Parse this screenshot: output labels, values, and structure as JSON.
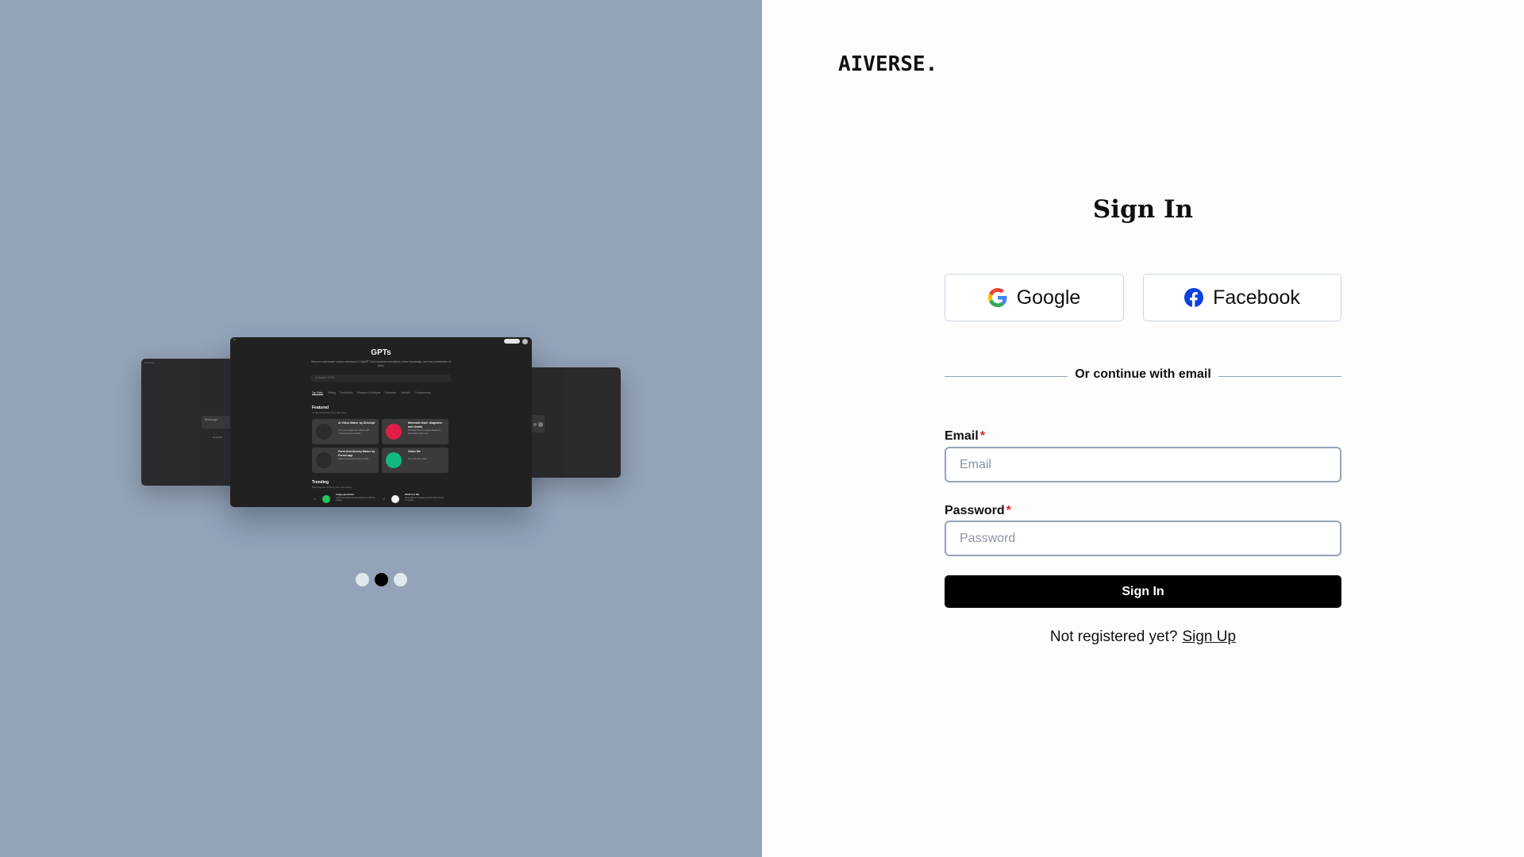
{
  "brand": {
    "logo": "AIVERSE."
  },
  "carousel": {
    "active_index": 1,
    "slide_count": 3,
    "main_slide": {
      "title": "GPTs",
      "subtitle": "Discover and create custom versions of ChatGPT that combine instructions, extra knowledge, and any combination of skills.",
      "search_placeholder": "Q  Search GPTs",
      "tabs": [
        "Top Picks",
        "Writing",
        "Productivity",
        "Research & Analysis",
        "Education",
        "Lifestyle",
        "Programming"
      ],
      "featured_title": "Featured",
      "featured_subtitle": "Curated top picks from this week",
      "cards": [
        {
          "title": "AI Video Maker by Descript",
          "desc": "Turn your ideas into videos with voiceovers and visuals.",
          "icon_color": "#2c2c2c"
        },
        {
          "title": "Mermaid chart: diagrams and charts",
          "desc": "Mermaid Chart creates diagrams, flowcharts and more.",
          "icon_color": "#e11d48"
        },
        {
          "title": "Form And Survey Maker by Forms.app",
          "desc": "Make forms and surveys easily.",
          "icon_color": "#2c2c2c"
        },
        {
          "title": "Video Me",
          "desc": "Turn text into video.",
          "icon_color": "#10b981"
        }
      ],
      "trending_title": "Trending",
      "trending_subtitle": "Most popular GPTs by our community",
      "trending": [
        {
          "num": "1",
          "title": "image generator",
          "desc": "A GPT specialized in generating and refining images.",
          "icon_color": "#22c55e"
        },
        {
          "num": "2",
          "title": "Write For Me",
          "desc": "Write tailored, engaging content with a focus on quality.",
          "icon_color": "#f5f5f5"
        }
      ]
    },
    "side_left": {
      "tag": "Overview",
      "input_text": "Message",
      "link_text": "Continue"
    },
    "side_right": {}
  },
  "auth": {
    "title": "Sign In",
    "google_label": "Google",
    "facebook_label": "Facebook",
    "divider_text": "Or continue with email",
    "email_label": "Email",
    "email_placeholder": "Email",
    "password_label": "Password",
    "password_placeholder": "Password",
    "required_marker": "*",
    "submit_label": "Sign In",
    "register_prompt": "Not registered yet?",
    "register_link": "Sign Up"
  },
  "colors": {
    "left_panel_bg": "#94a3b8",
    "primary_button": "#000000",
    "required": "#dc2626",
    "facebook_blue": "#1877f2"
  }
}
